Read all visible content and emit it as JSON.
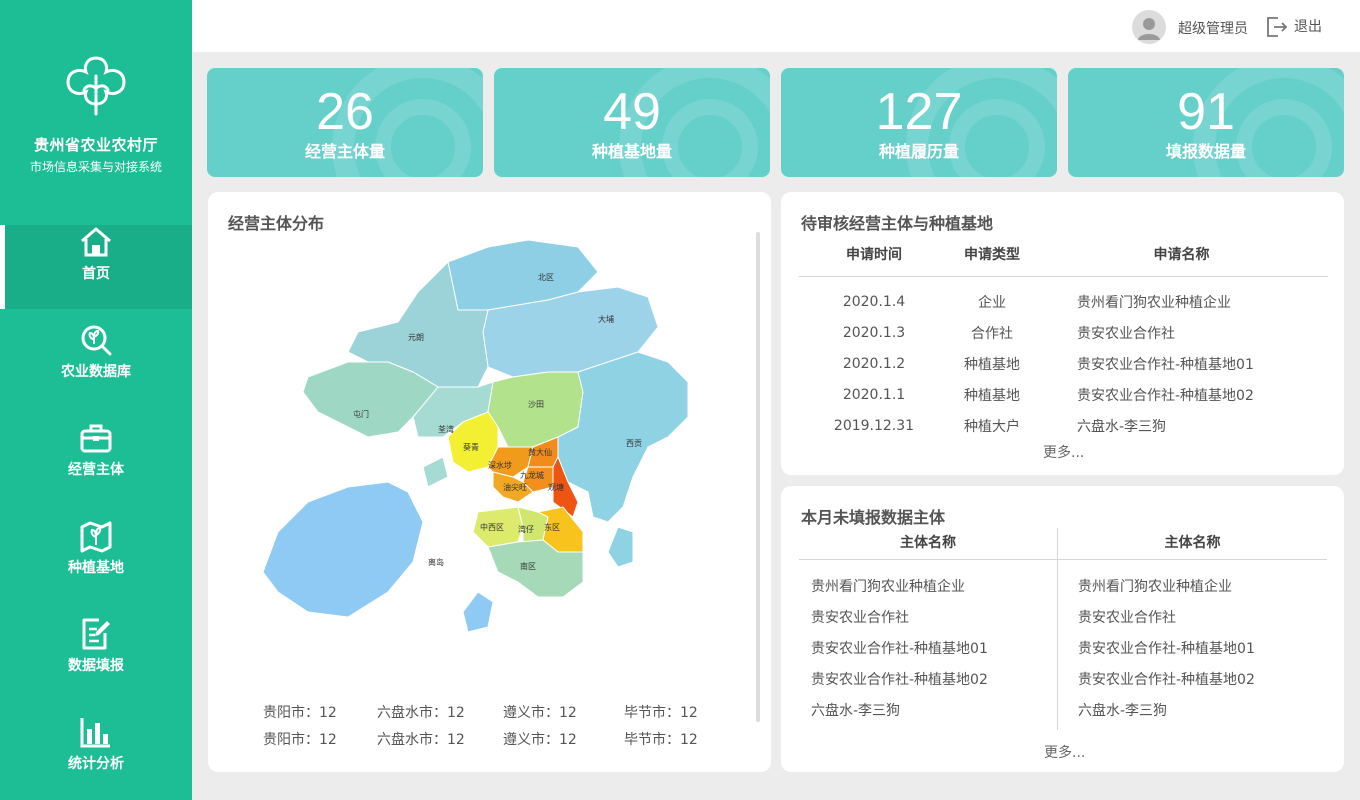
{
  "sidebar": {
    "org_name": "贵州省农业农村厅",
    "system_name": "市场信息采集与对接系统",
    "items": [
      {
        "label": "首页",
        "icon": "home-icon"
      },
      {
        "label": "农业数据库",
        "icon": "plant-search-icon"
      },
      {
        "label": "经营主体",
        "icon": "briefcase-icon"
      },
      {
        "label": "种植基地",
        "icon": "map-plant-icon"
      },
      {
        "label": "数据填报",
        "icon": "edit-document-icon"
      },
      {
        "label": "统计分析",
        "icon": "bar-chart-icon"
      }
    ]
  },
  "header": {
    "user_name": "超级管理员",
    "logout_label": "退出"
  },
  "stats": [
    {
      "value": "26",
      "label": "经营主体量"
    },
    {
      "value": "49",
      "label": "种植基地量"
    },
    {
      "value": "127",
      "label": "种植履历量"
    },
    {
      "value": "91",
      "label": "填报数据量"
    }
  ],
  "map_panel": {
    "title": "经营主体分布",
    "regions": [
      "北区",
      "大埔",
      "元朗",
      "屯门",
      "沙田",
      "荃湾",
      "葵青",
      "深水埗",
      "黄大仙",
      "九龙城",
      "油尖旺",
      "观塘",
      "西贡",
      "中西区",
      "湾仔",
      "东区",
      "南区",
      "离岛"
    ],
    "legend": [
      {
        "city": "贵阳市",
        "count": "12"
      },
      {
        "city": "六盘水市",
        "count": "12"
      },
      {
        "city": "遵义市",
        "count": "12"
      },
      {
        "city": "毕节市",
        "count": "12"
      },
      {
        "city": "贵阳市",
        "count": "12"
      },
      {
        "city": "六盘水市",
        "count": "12"
      },
      {
        "city": "遵义市",
        "count": "12"
      },
      {
        "city": "毕节市",
        "count": "12"
      }
    ]
  },
  "pending_panel": {
    "title": "待审核经营主体与种植基地",
    "columns": [
      "申请时间",
      "申请类型",
      "申请名称"
    ],
    "rows": [
      [
        "2020.1.4",
        "企业",
        "贵州看门狗农业种植企业"
      ],
      [
        "2020.1.3",
        "合作社",
        "贵安农业合作社"
      ],
      [
        "2020.1.2",
        "种植基地",
        "贵安农业合作社-种植基地01"
      ],
      [
        "2020.1.1",
        "种植基地",
        "贵安农业合作社-种植基地02"
      ],
      [
        "2019.12.31",
        "种植大户",
        "六盘水-李三狗"
      ]
    ],
    "more_label": "更多..."
  },
  "unfilled_panel": {
    "title": "本月未填报数据主体",
    "columns": [
      "主体名称",
      "主体名称"
    ],
    "left": [
      "贵州看门狗农业种植企业",
      "贵安农业合作社",
      "贵安农业合作社-种植基地01",
      "贵安农业合作社-种植基地02",
      "六盘水-李三狗"
    ],
    "right": [
      "贵州看门狗农业种植企业",
      "贵安农业合作社",
      "贵安农业合作社-种植基地01",
      "贵安农业合作社-种植基地02",
      "六盘水-李三狗"
    ],
    "more_label": "更多..."
  },
  "colors": {
    "sidebar": "#1dbe95",
    "card": "#65cfca"
  }
}
